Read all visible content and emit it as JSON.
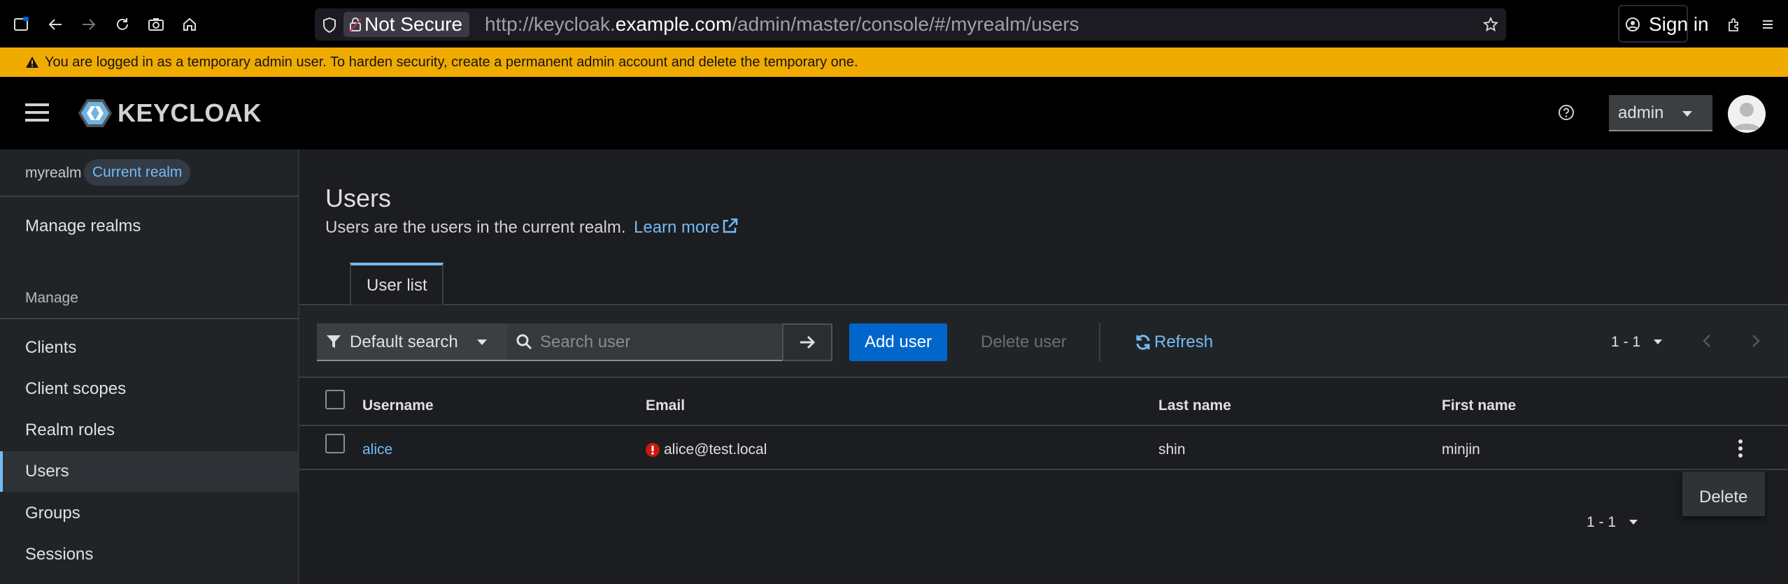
{
  "browser": {
    "security_label": "Not Secure",
    "url_prefix": "http://keycloak.",
    "url_domain": "example.com",
    "url_path": "/admin/master/console/#/myrealm/users",
    "sign_in_label": "Sign in"
  },
  "banner": {
    "text": "You are logged in as a temporary admin user. To harden security, create a permanent admin account and delete the temporary one.",
    "color": "#f0ab00"
  },
  "masthead": {
    "logo_text": "KEYCLOAK",
    "user_menu_label": "admin"
  },
  "sidebar": {
    "realm_name": "myrealm",
    "realm_badge": "Current realm",
    "manage_realms": "Manage realms",
    "section_label": "Manage",
    "items": [
      {
        "label": "Clients"
      },
      {
        "label": "Client scopes"
      },
      {
        "label": "Realm roles"
      },
      {
        "label": "Users",
        "active": true
      },
      {
        "label": "Groups"
      },
      {
        "label": "Sessions"
      }
    ]
  },
  "main": {
    "title": "Users",
    "description": "Users are the users in the current realm.",
    "learn_more": "Learn more",
    "tabs": [
      {
        "label": "User list",
        "active": true
      }
    ],
    "toolbar": {
      "search_type": "Default search",
      "search_placeholder": "Search user",
      "add_user": "Add user",
      "delete_user": "Delete user",
      "refresh": "Refresh",
      "pagination": "1 - 1"
    },
    "table": {
      "columns": [
        "Username",
        "Email",
        "Last name",
        "First name"
      ],
      "rows": [
        {
          "username": "alice",
          "email": "alice@test.local",
          "email_unverified": true,
          "last_name": "shin",
          "first_name": "minjin"
        }
      ]
    },
    "row_menu": {
      "delete": "Delete"
    },
    "pagination_bottom": "1 - 1"
  },
  "colors": {
    "accent": "#73bcf7",
    "primary_button": "#0066cc",
    "warning_icon": "#c9190b"
  }
}
